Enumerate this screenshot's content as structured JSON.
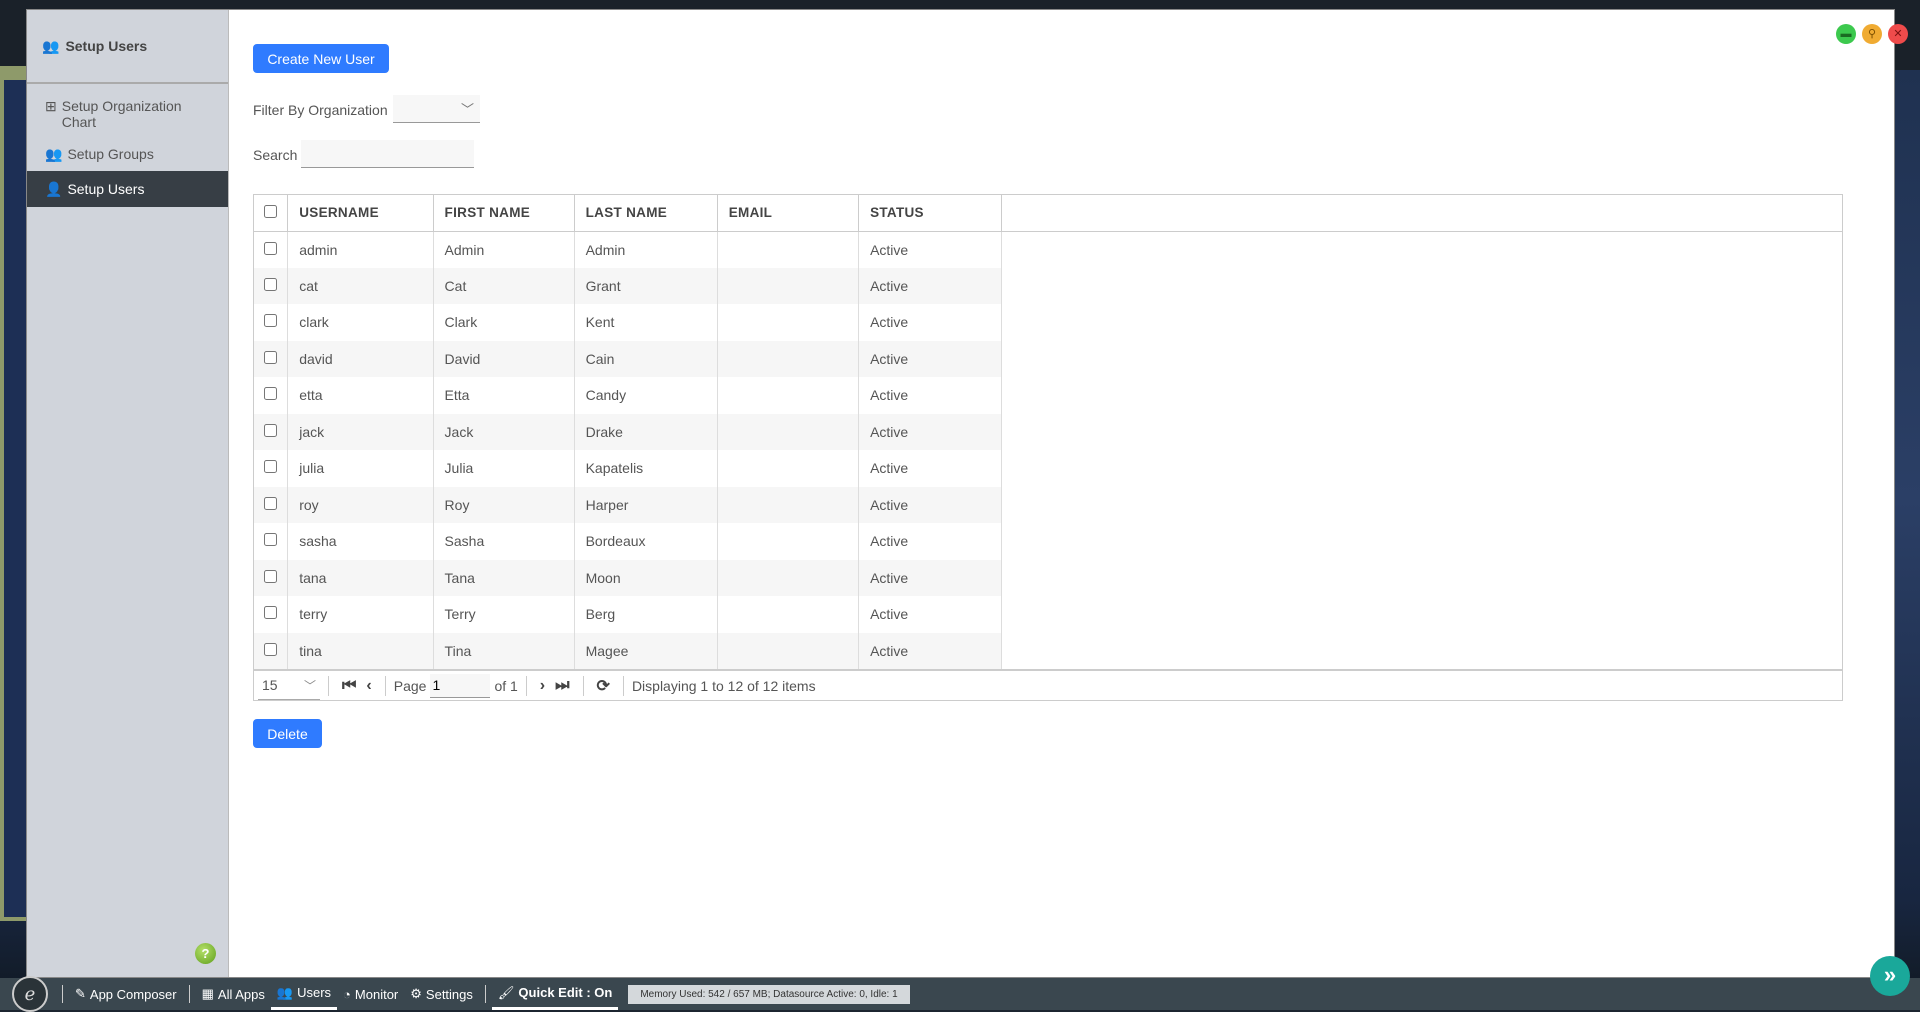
{
  "window": {
    "controls": [
      {
        "name": "maximize",
        "color": "#3cc94e"
      },
      {
        "name": "pin",
        "color": "#f0ab32"
      },
      {
        "name": "close",
        "color": "#ef4b4b"
      }
    ]
  },
  "sidebar": {
    "title": "Setup Users",
    "items": [
      {
        "label": "Setup Organization Chart",
        "icon": "sitemap-icon"
      },
      {
        "label": "Setup Groups",
        "icon": "users-icon"
      },
      {
        "label": "Setup Users",
        "icon": "user-icon",
        "active": true
      }
    ],
    "help": "?"
  },
  "main": {
    "create_button": "Create New User",
    "filter_label": "Filter By Organization",
    "filter_value": "",
    "search_label": "Search",
    "search_value": "",
    "delete_button": "Delete"
  },
  "table": {
    "columns": [
      "USERNAME",
      "FIRST NAME",
      "LAST NAME",
      "EMAIL",
      "STATUS"
    ],
    "rows": [
      [
        "admin",
        "Admin",
        "Admin",
        "",
        "Active"
      ],
      [
        "cat",
        "Cat",
        "Grant",
        "",
        "Active"
      ],
      [
        "clark",
        "Clark",
        "Kent",
        "",
        "Active"
      ],
      [
        "david",
        "David",
        "Cain",
        "",
        "Active"
      ],
      [
        "etta",
        "Etta",
        "Candy",
        "",
        "Active"
      ],
      [
        "jack",
        "Jack",
        "Drake",
        "",
        "Active"
      ],
      [
        "julia",
        "Julia",
        "Kapatelis",
        "",
        "Active"
      ],
      [
        "roy",
        "Roy",
        "Harper",
        "",
        "Active"
      ],
      [
        "sasha",
        "Sasha",
        "Bordeaux",
        "",
        "Active"
      ],
      [
        "tana",
        "Tana",
        "Moon",
        "",
        "Active"
      ],
      [
        "terry",
        "Terry",
        "Berg",
        "",
        "Active"
      ],
      [
        "tina",
        "Tina",
        "Magee",
        "",
        "Active"
      ]
    ]
  },
  "pager": {
    "page_size": "15",
    "page_label": "Page",
    "page": "1",
    "of_label": "of 1",
    "display": "Displaying 1 to 12 of 12 items"
  },
  "taskbar": {
    "items": [
      "App Composer",
      "All Apps",
      "Users",
      "Monitor",
      "Settings"
    ],
    "quick_edit": "Quick Edit : On",
    "memory": "Memory Used: 542 / 657 MB; Datasource Active: 0, Idle: 1"
  },
  "accent": "#2f7bff"
}
